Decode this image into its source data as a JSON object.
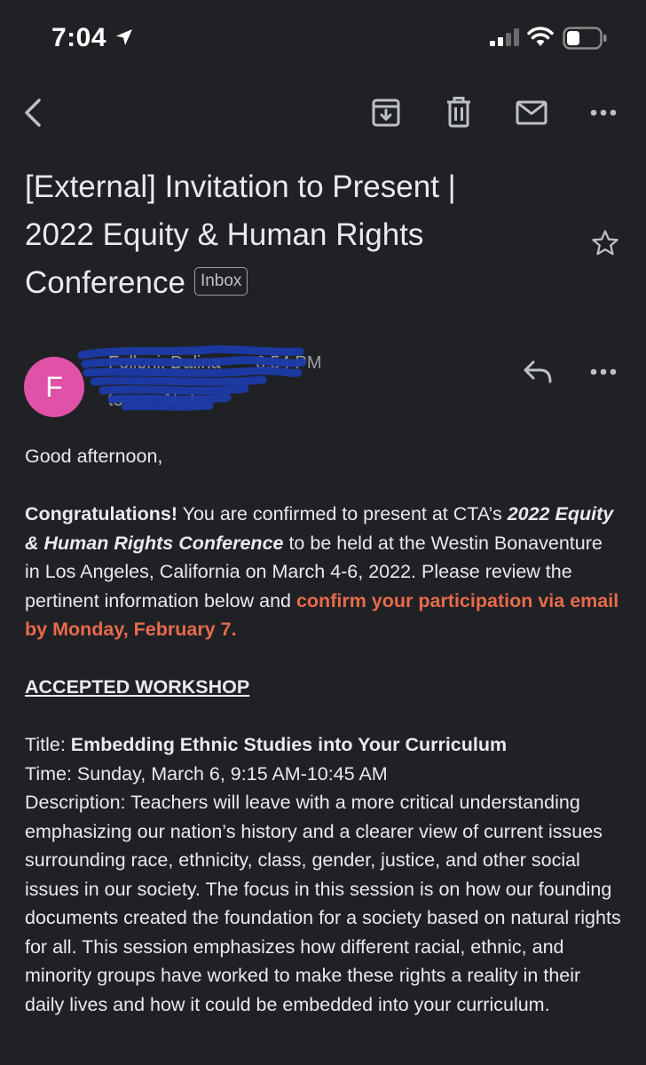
{
  "status_bar": {
    "time": "7:04"
  },
  "icons": {
    "back": "chevron-left-icon",
    "archive": "archive-icon",
    "delete": "trash-icon",
    "mark_unread": "mail-icon",
    "more": "more-horizontal-icon",
    "star": "star-icon",
    "reply": "reply-icon",
    "message_more": "more-horizontal-icon"
  },
  "email": {
    "subject_line1": "[External] Invitation to Present |",
    "subject_line2": "2022 Equity & Human Rights",
    "subject_line3": "Conference",
    "label": "Inbox",
    "sender_initial": "F",
    "sender_name": "Folloni, Dalina",
    "time": "6:54 PM",
    "recipient": "to me, Alisha"
  },
  "body": {
    "greeting": "Good afternoon,",
    "congrats": "Congratulations!",
    "p1_a": " You are confirmed to present at CTA’s ",
    "p1_conf": "2022 Equity & Human Rights Conference",
    "p1_b": " to be held at the Westin Bonaventure in Los Angeles, California on March 4-6, 2022. Please review the pertinent information below and ",
    "p1_highlight": "confirm your participation via email by Monday, February 7.",
    "section_heading": "ACCEPTED WORKSHOP",
    "title_label": "Title: ",
    "title_value": "Embedding Ethnic Studies into Your Curriculum",
    "time_line": "Time: Sunday, March 6, 9:15 AM-10:45 AM",
    "description": "Description: Teachers will leave with a more critical understanding emphasizing our nation’s history and a clearer view of current issues surrounding race, ethnicity, class, gender, justice, and other social issues in our society. The focus in this session is on how our founding documents created the foundation for a society based on natural rights for all. This session emphasizes how different racial, ethnic, and minority groups have worked to make these rights a reality in their daily lives and how it could be embedded into your curriculum."
  },
  "colors": {
    "background": "#202124",
    "avatar": "#e052a8",
    "highlight": "#e86a4c"
  }
}
